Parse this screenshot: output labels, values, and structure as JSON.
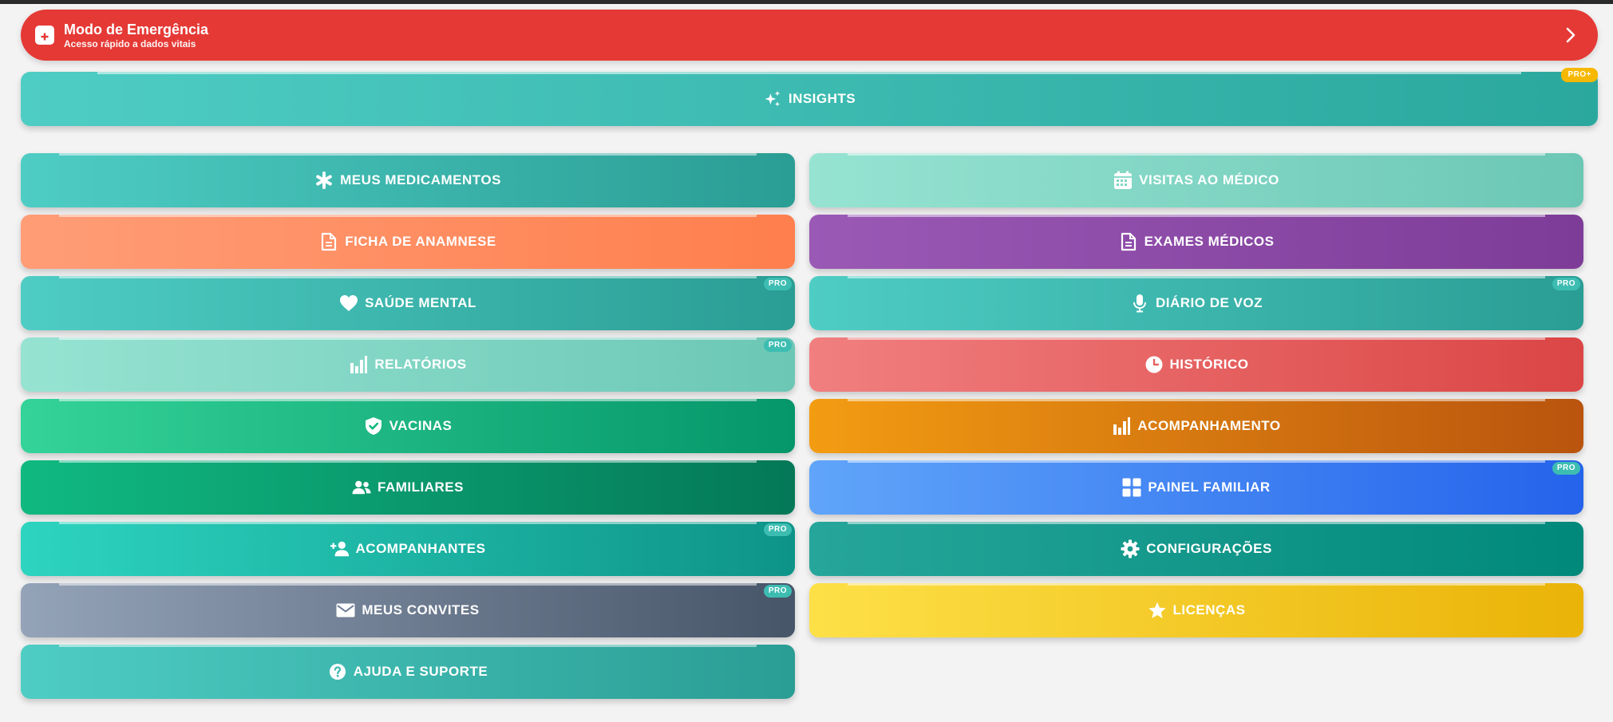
{
  "emergency": {
    "title": "Modo de Emergência",
    "subtitle": "Acesso rápido a dados vitais"
  },
  "insights": {
    "label": "INSIGHTS",
    "badge": "PRO+"
  },
  "menu": {
    "left": [
      {
        "label": "MEUS MEDICAMENTOS",
        "icon": "asterisk-icon"
      },
      {
        "label": "FICHA DE ANAMNESE",
        "icon": "document-icon"
      },
      {
        "label": "SAÚDE MENTAL",
        "icon": "heart-icon",
        "badge": "PRO"
      },
      {
        "label": "RELATÓRIOS",
        "icon": "bar-chart-icon",
        "badge": "PRO"
      },
      {
        "label": "VACINAS",
        "icon": "shield-check-icon"
      },
      {
        "label": "FAMILIARES",
        "icon": "users-icon"
      },
      {
        "label": "ACOMPANHANTES",
        "icon": "user-plus-icon",
        "badge": "PRO"
      },
      {
        "label": "MEUS CONVITES",
        "icon": "envelope-icon",
        "badge": "PRO"
      },
      {
        "label": "AJUDA E SUPORTE",
        "icon": "question-icon"
      }
    ],
    "right": [
      {
        "label": "VISITAS AO MÉDICO",
        "icon": "calendar-icon"
      },
      {
        "label": "EXAMES MÉDICOS",
        "icon": "document-icon"
      },
      {
        "label": "DIÁRIO DE VOZ",
        "icon": "microphone-icon",
        "badge": "PRO"
      },
      {
        "label": "HISTÓRICO",
        "icon": "clock-icon"
      },
      {
        "label": "ACOMPANHAMENTO",
        "icon": "bar-chart-icon"
      },
      {
        "label": "PAINEL FAMILIAR",
        "icon": "grid-icon",
        "badge": "PRO"
      },
      {
        "label": "CONFIGURAÇÕES",
        "icon": "gear-icon"
      },
      {
        "label": "LICENÇAS",
        "icon": "star-icon"
      }
    ]
  },
  "colors": {
    "emergency": "#e53935",
    "teal": "#4ecdc4",
    "badge": "#3dbdb2",
    "badge_plus": "#f6b800"
  }
}
